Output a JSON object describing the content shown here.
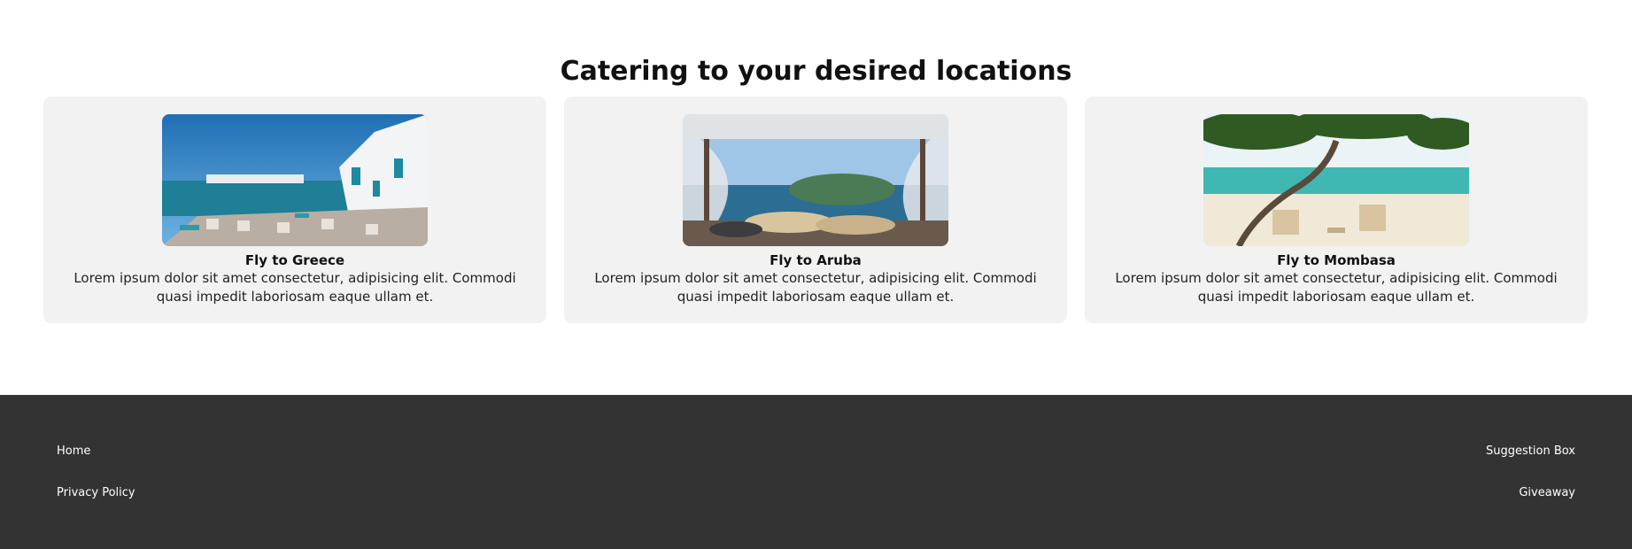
{
  "section": {
    "heading": "Catering to your desired locations"
  },
  "cards": [
    {
      "title": "Fly to Greece",
      "text": "Lorem ipsum dolor sit amet consectetur, adipisicing elit. Commodi quasi impedit laboriosam eaque ullam et.",
      "image": "greece-harbor-photo"
    },
    {
      "title": "Fly to Aruba",
      "text": "Lorem ipsum dolor sit amet consectetur, adipisicing elit. Commodi quasi impedit laboriosam eaque ullam et.",
      "image": "aruba-cabana-photo"
    },
    {
      "title": "Fly to Mombasa",
      "text": "Lorem ipsum dolor sit amet consectetur, adipisicing elit. Commodi quasi impedit laboriosam eaque ullam et.",
      "image": "mombasa-beach-photo"
    }
  ],
  "footer": {
    "home": "Home",
    "privacy": "Privacy Policy",
    "suggestion": "Suggestion Box",
    "giveaway": "Giveaway"
  },
  "colors": {
    "card_bg": "#f2f2f2",
    "footer_bg": "#333333"
  }
}
